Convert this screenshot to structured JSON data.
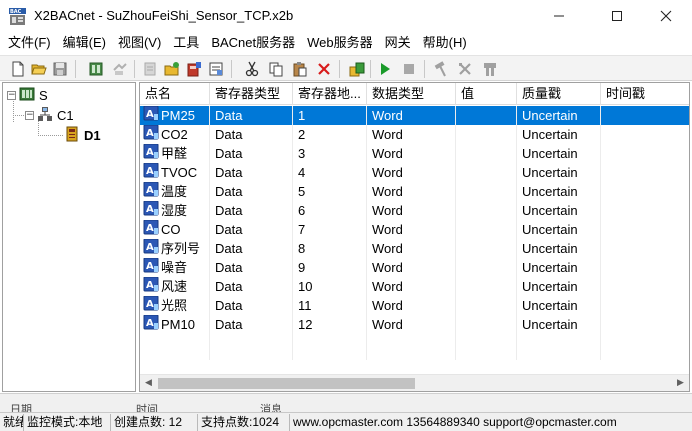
{
  "window": {
    "title": "X2BACnet - SuZhouFeiShi_Sensor_TCP.x2b",
    "app_icon": "x2bacnet-app-icon",
    "controls": [
      "minimize-icon",
      "maximize-icon",
      "close-icon"
    ]
  },
  "menu": [
    {
      "label": "文件(F)"
    },
    {
      "label": "编辑(E)"
    },
    {
      "label": "视图(V)"
    },
    {
      "label": "工具"
    },
    {
      "label": "BACnet服务器"
    },
    {
      "label": "Web服务器"
    },
    {
      "label": "网关"
    },
    {
      "label": "帮助(H)"
    }
  ],
  "toolbar": {
    "buttons": [
      "new-file-icon",
      "open-folder-icon",
      "save-icon",
      "add-server-icon",
      "disabled-tool-icon",
      "disabled-tool-icon",
      "new-channel-icon",
      "new-device-icon",
      "properties-icon",
      "cut-icon",
      "copy-icon",
      "paste-icon",
      "delete-icon",
      "data-tool-icon",
      "run-icon",
      "stop-icon",
      "hammer-icon",
      "wrench-icon",
      "tools-icon"
    ]
  },
  "tree": {
    "root": {
      "label": "S",
      "expander": "−"
    },
    "channel": {
      "label": "C1",
      "expander": "−"
    },
    "device": {
      "label": "D1"
    }
  },
  "grid": {
    "columns": [
      "点名",
      "寄存器类型",
      "寄存器地...",
      "数据类型",
      "值",
      "质量戳",
      "时间戳"
    ],
    "rows": [
      {
        "name": "PM25",
        "reg_type": "Data",
        "address": "1",
        "data_type": "Word",
        "value": "",
        "quality": "Uncertain",
        "timestamp": ""
      },
      {
        "name": "CO2",
        "reg_type": "Data",
        "address": "2",
        "data_type": "Word",
        "value": "",
        "quality": "Uncertain",
        "timestamp": ""
      },
      {
        "name": "甲醛",
        "reg_type": "Data",
        "address": "3",
        "data_type": "Word",
        "value": "",
        "quality": "Uncertain",
        "timestamp": ""
      },
      {
        "name": "TVOC",
        "reg_type": "Data",
        "address": "4",
        "data_type": "Word",
        "value": "",
        "quality": "Uncertain",
        "timestamp": ""
      },
      {
        "name": "温度",
        "reg_type": "Data",
        "address": "5",
        "data_type": "Word",
        "value": "",
        "quality": "Uncertain",
        "timestamp": ""
      },
      {
        "name": "湿度",
        "reg_type": "Data",
        "address": "6",
        "data_type": "Word",
        "value": "",
        "quality": "Uncertain",
        "timestamp": ""
      },
      {
        "name": "CO",
        "reg_type": "Data",
        "address": "7",
        "data_type": "Word",
        "value": "",
        "quality": "Uncertain",
        "timestamp": ""
      },
      {
        "name": "序列号",
        "reg_type": "Data",
        "address": "8",
        "data_type": "Word",
        "value": "",
        "quality": "Uncertain",
        "timestamp": ""
      },
      {
        "name": "噪音",
        "reg_type": "Data",
        "address": "9",
        "data_type": "Word",
        "value": "",
        "quality": "Uncertain",
        "timestamp": ""
      },
      {
        "name": "风速",
        "reg_type": "Data",
        "address": "10",
        "data_type": "Word",
        "value": "",
        "quality": "Uncertain",
        "timestamp": ""
      },
      {
        "name": "光照",
        "reg_type": "Data",
        "address": "11",
        "data_type": "Word",
        "value": "",
        "quality": "Uncertain",
        "timestamp": ""
      },
      {
        "name": "PM10",
        "reg_type": "Data",
        "address": "12",
        "data_type": "Word",
        "value": "",
        "quality": "Uncertain",
        "timestamp": ""
      }
    ],
    "selected_row": 0
  },
  "lower_tabs": [
    "日期",
    "时间",
    "消息"
  ],
  "status": {
    "ready": "就绪",
    "mode": "监控模式:本地",
    "created": "创建点数: 12",
    "supported": "支持点数:1024",
    "contact": "www.opcmaster.com 13564889340 support@opcmaster.com"
  },
  "colors": {
    "selection": "#0078d7",
    "run_green": "#1a9a2a",
    "delete_red": "#d81b1b"
  }
}
